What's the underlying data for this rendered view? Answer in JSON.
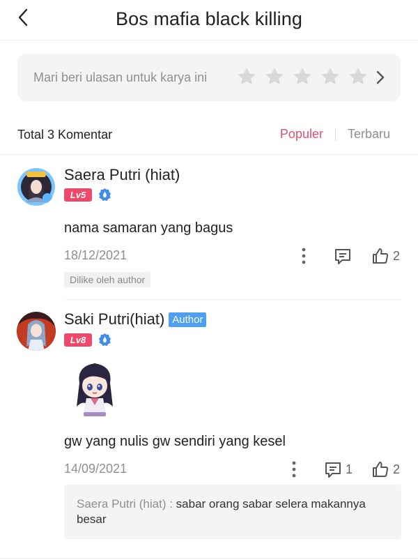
{
  "header": {
    "title": "Bos mafia black killing"
  },
  "review": {
    "prompt": "Mari beri ulasan untuk karya ini",
    "stars": 5,
    "star_color": "#d8d8d8"
  },
  "comments_bar": {
    "total": "Total 3 Komentar",
    "sort_popular": "Populer",
    "sort_latest": "Terbaru",
    "accent": "#e0536f"
  },
  "comments": [
    {
      "name": "Saera Putri (hiat)",
      "level": "Lv5",
      "text": "nama samaran yang bagus",
      "date": "18/12/2021",
      "likes": "2",
      "liked_by_author": "Dilike oleh author"
    },
    {
      "name": "Saki Putri(hiat)",
      "author_badge": "Author",
      "level": "Lv8",
      "text": "gw yang nulis gw sendiri yang kesel",
      "date": "14/09/2021",
      "replies": "1",
      "likes": "2",
      "reply": {
        "user": "Saera Putri (hiat) :",
        "text": " sabar orang sabar selera makannya besar"
      }
    }
  ],
  "icons": [
    "back-arrow-icon",
    "star-icon",
    "chevron-right-icon",
    "more-vertical-icon",
    "reply-icon",
    "thumbs-up-icon",
    "verified-badge-icon"
  ]
}
